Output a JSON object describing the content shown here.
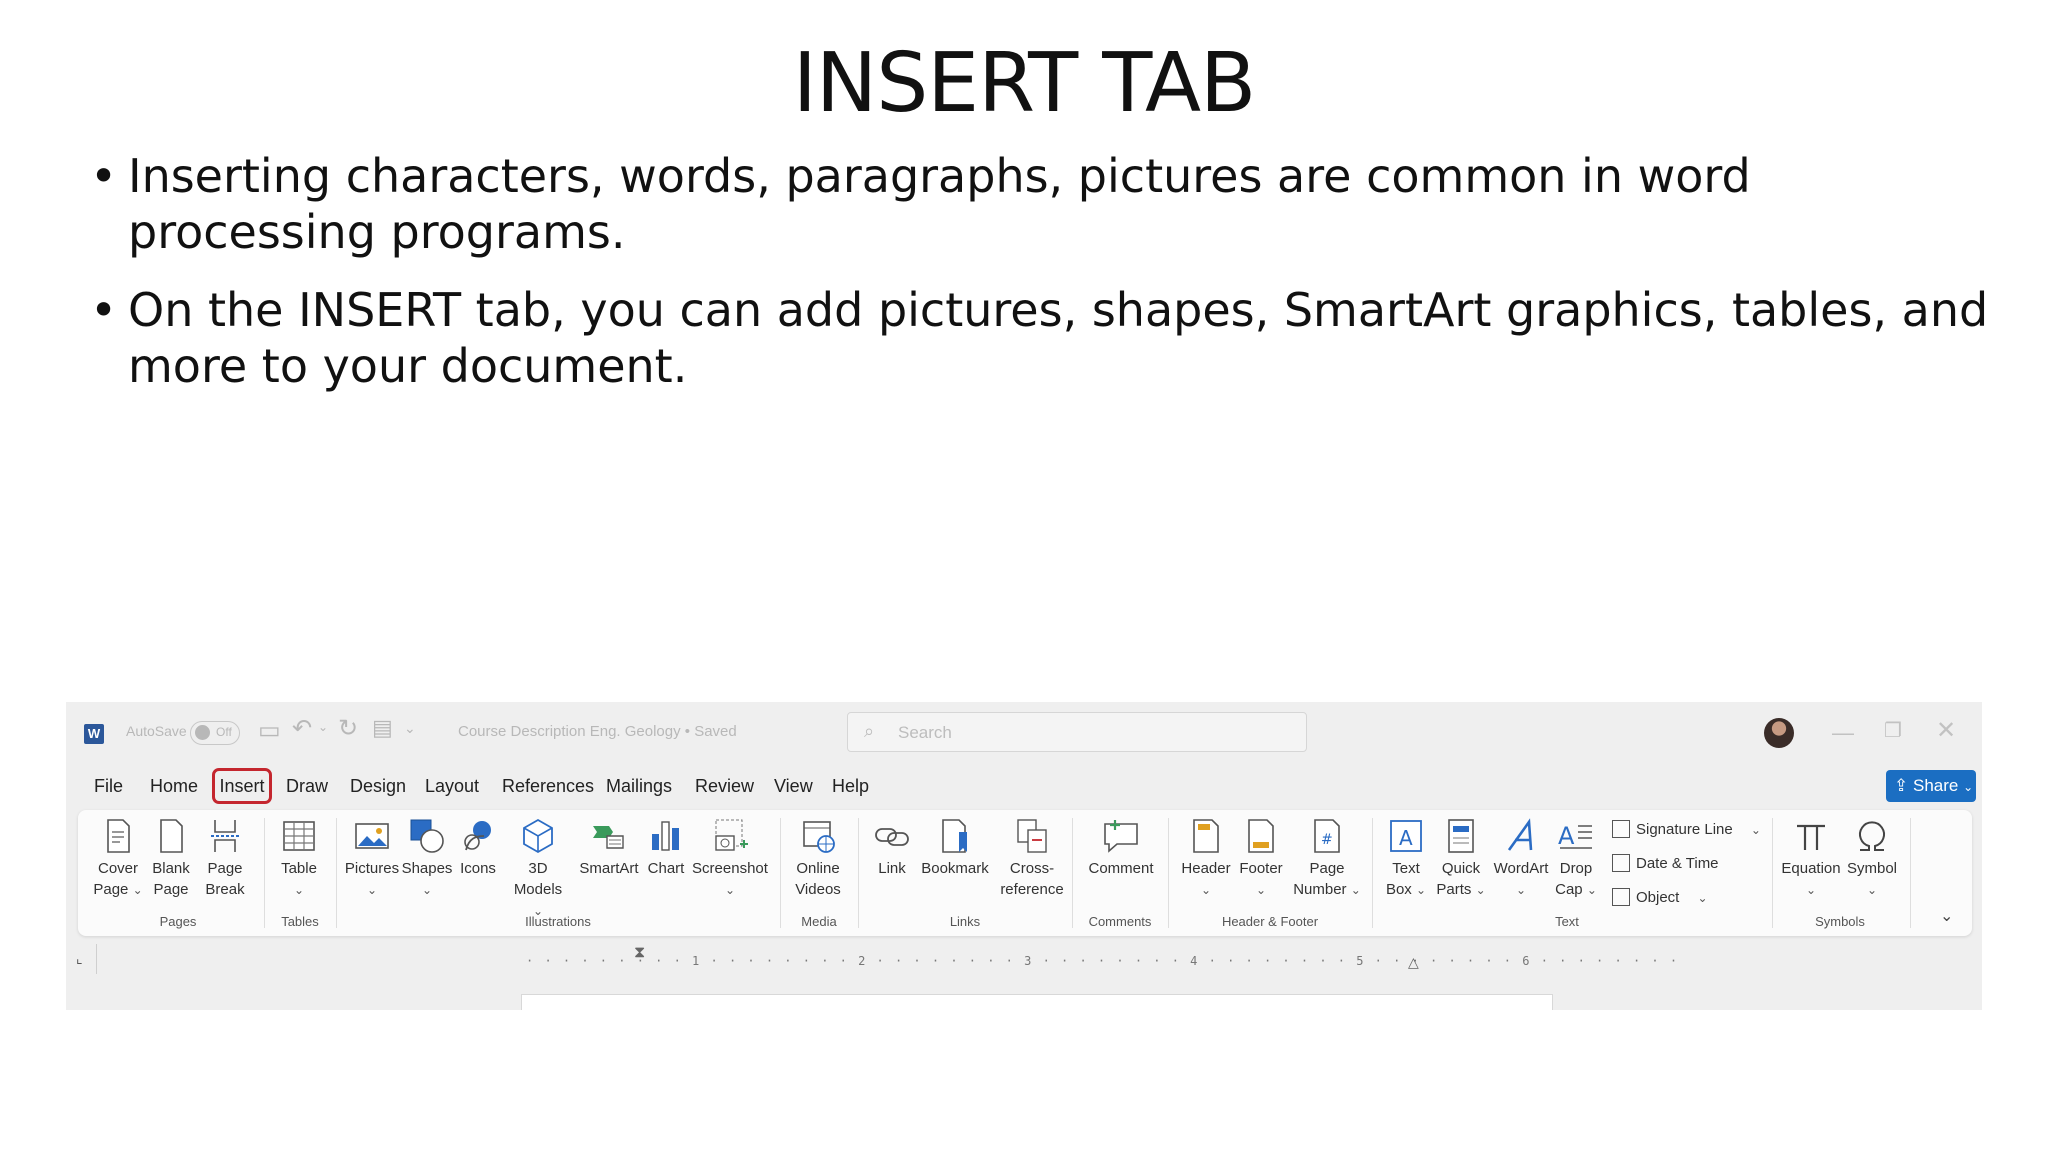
{
  "slide": {
    "title": "INSERT TAB",
    "bullets": [
      "Inserting characters, words, paragraphs, pictures are common in word processing programs.",
      "On the INSERT tab, you can add pictures, shapes, SmartArt graphics, tables, and more to your document."
    ]
  },
  "word": {
    "titlebar": {
      "autosave_label": "AutoSave",
      "autosave_state": "Off",
      "doc_title": "Course Description Eng. Geology • Saved",
      "search_placeholder": "Search"
    },
    "menu": [
      "File",
      "Home",
      "Insert",
      "Draw",
      "Design",
      "Layout",
      "References",
      "Mailings",
      "Review",
      "View",
      "Help"
    ],
    "share_label": "Share",
    "groups": {
      "pages": "Pages",
      "tables": "Tables",
      "illustrations": "Illustrations",
      "media": "Media",
      "links": "Links",
      "comments": "Comments",
      "header_footer": "Header & Footer",
      "text": "Text",
      "symbols": "Symbols"
    },
    "ribbon": {
      "cover_page": [
        "Cover",
        "Page"
      ],
      "blank_page": [
        "Blank",
        "Page"
      ],
      "page_break": [
        "Page",
        "Break"
      ],
      "table": "Table",
      "pictures": "Pictures",
      "shapes": "Shapes",
      "icons": "Icons",
      "models": [
        "3D",
        "Models"
      ],
      "smartart": "SmartArt",
      "chart": "Chart",
      "screenshot": "Screenshot",
      "online_videos": [
        "Online",
        "Videos"
      ],
      "link": "Link",
      "bookmark": "Bookmark",
      "cross_reference": [
        "Cross-",
        "reference"
      ],
      "comment": "Comment",
      "header": "Header",
      "footer": "Footer",
      "page_number": [
        "Page",
        "Number"
      ],
      "text_box": [
        "Text",
        "Box"
      ],
      "quick_parts": [
        "Quick",
        "Parts"
      ],
      "wordart": "WordArt",
      "drop_cap": [
        "Drop",
        "Cap"
      ],
      "signature_line": "Signature Line",
      "date_time": "Date & Time",
      "object": "Object",
      "equation": "Equation",
      "symbol": "Symbol"
    },
    "ruler_ticks": "· · · · · · · · · 1 · · · · · · · · 2 · · · · · · · · 3 · · · · · · · · 4 · · · · · · · · 5 · · · · · · · · 6 · · · · · · · ·"
  }
}
